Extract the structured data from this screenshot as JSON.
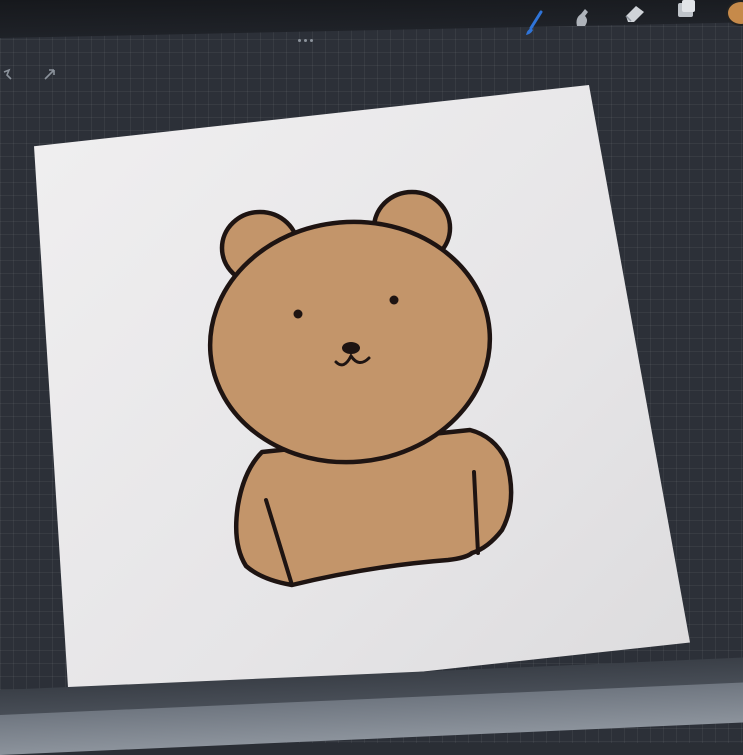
{
  "app": {
    "toolbar": {
      "left_tools": [
        {
          "icon": "wrench-icon"
        },
        {
          "icon": "cursor-arrow-icon"
        }
      ],
      "right_tools": [
        {
          "icon": "brush-icon",
          "active": true,
          "color": "#2f74d8"
        },
        {
          "icon": "smudge-icon",
          "active": false
        },
        {
          "icon": "eraser-icon",
          "active": false
        },
        {
          "icon": "layers-icon",
          "active": false
        }
      ],
      "more_menu_icon": "ellipsis-icon",
      "current_color": "#c68a4a"
    },
    "canvas": {
      "background": "#ebeaec",
      "drawing": {
        "subject": "bear",
        "fill_color": "#c3956a",
        "outline_color": "#1e1412"
      }
    }
  }
}
